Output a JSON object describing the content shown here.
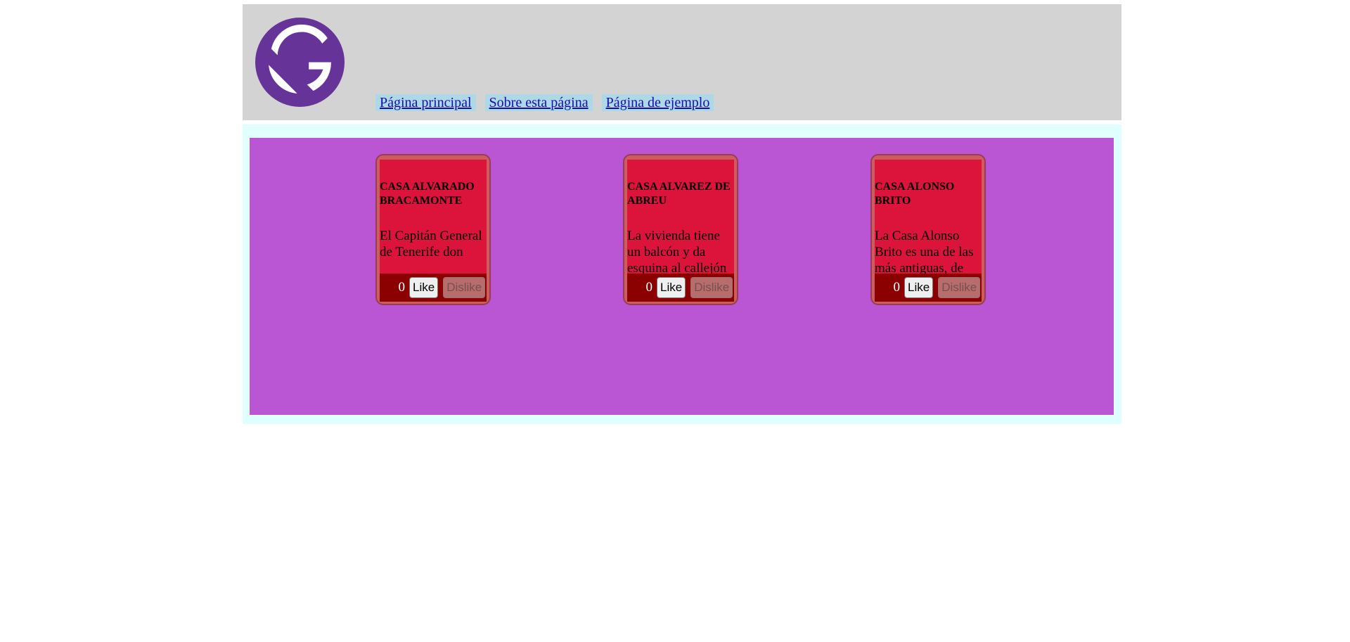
{
  "header": {
    "logo": "gatsby-logo",
    "nav": [
      {
        "label": "Página principal"
      },
      {
        "label": "Sobre esta página"
      },
      {
        "label": "Página de ejemplo"
      }
    ]
  },
  "cards": [
    {
      "title": "CASA ALVARADO BRACAMONTE",
      "text": "El Capitán General de Tenerife don",
      "likes": "0",
      "like_label": "Like",
      "dislike_label": "Dislike"
    },
    {
      "title": "CASA ALVAREZ DE ABREU",
      "text": "La vivienda tiene un balcón y da esquina al callejón",
      "likes": "0",
      "like_label": "Like",
      "dislike_label": "Dislike"
    },
    {
      "title": "CASA ALONSO BRITO",
      "text": "La Casa Alonso Brito es una de las más antiguas, de",
      "likes": "0",
      "like_label": "Like",
      "dislike_label": "Dislike"
    }
  ],
  "colors": {
    "header_bg": "#d3d3d3",
    "nav_bg": "#add8e6",
    "main_outer_bg": "#e0ffff",
    "main_inner_bg": "#ba55d3",
    "card_bg": "#cd5c5c",
    "card_body_bg": "#dc143c",
    "card_footer_bg": "#8b0000",
    "logo_purple": "#663399"
  }
}
